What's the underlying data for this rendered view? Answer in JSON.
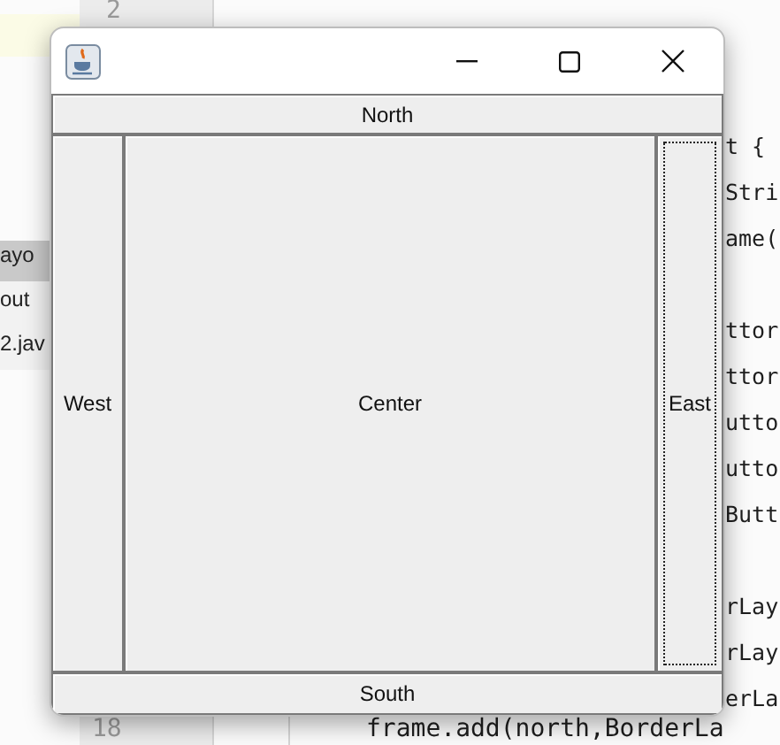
{
  "ide": {
    "line_numbers": [
      "2",
      "18"
    ],
    "project_items": [
      {
        "label": "ayo",
        "selected": true
      },
      {
        "label": "out",
        "selected": false
      },
      {
        "label": "2.jav",
        "selected": false
      }
    ],
    "code_groups": [
      [
        "t {",
        "Stri",
        "ame("
      ],
      [
        "ttor",
        "ttor",
        "utto",
        "utto",
        "Butt"
      ],
      [
        "rLay",
        "rLay",
        "erLa"
      ]
    ],
    "bottom_code": "frame.add(north,BorderLa"
  },
  "window": {
    "buttons": [
      {
        "label": "North",
        "kind": "top",
        "focused": false
      },
      {
        "label": "West",
        "kind": "left",
        "focused": false
      },
      {
        "label": "Center",
        "kind": "middle",
        "focused": false
      },
      {
        "label": "East",
        "kind": "right",
        "focused": true
      },
      {
        "label": "South",
        "kind": "bottom",
        "focused": false
      }
    ]
  }
}
